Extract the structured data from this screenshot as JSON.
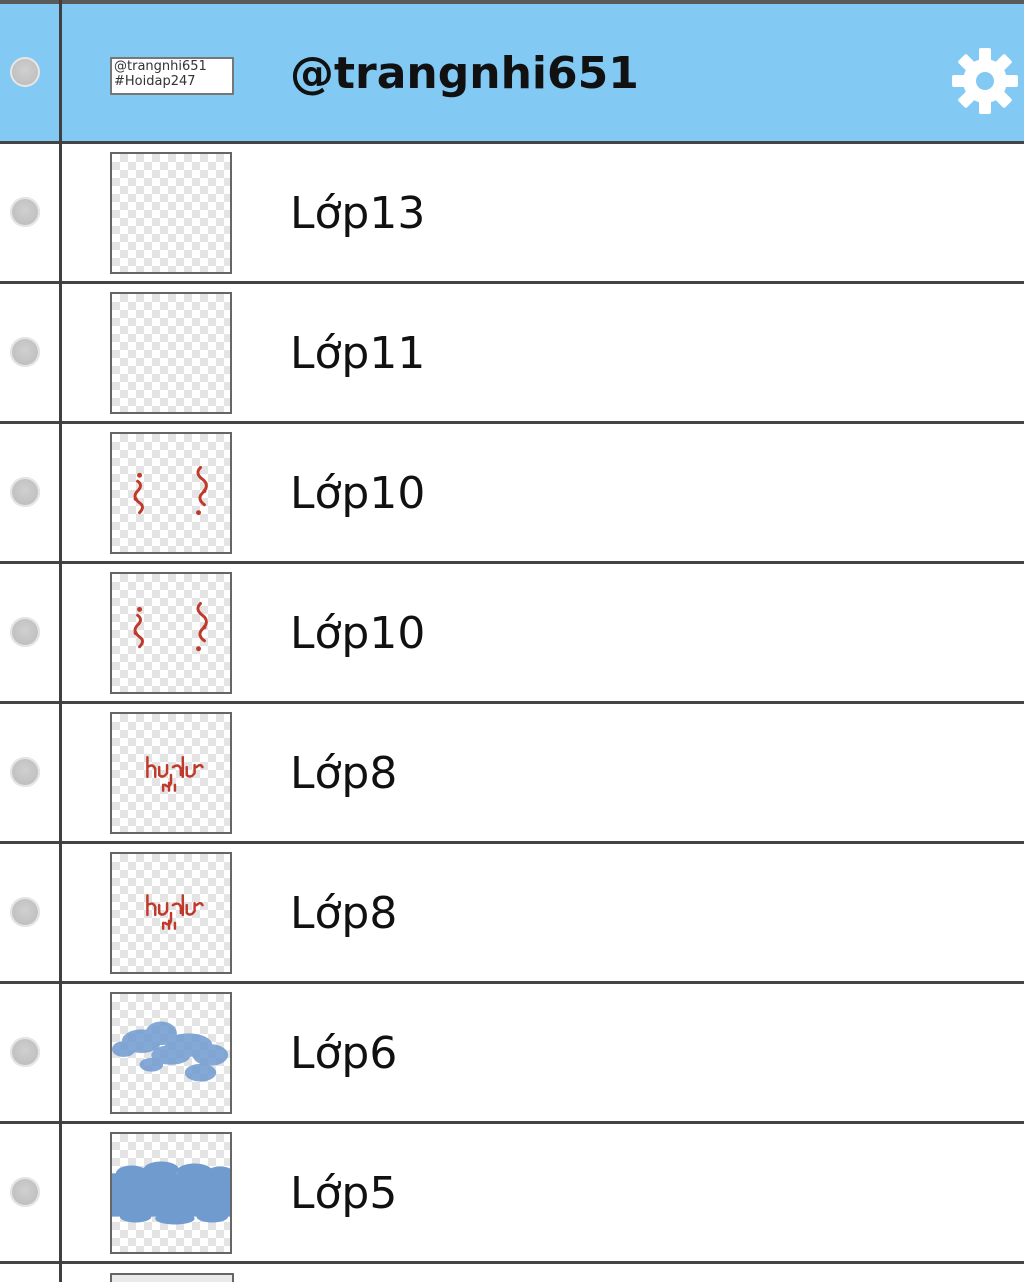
{
  "layers_panel": {
    "selected_layer": {
      "name": "@trangnhi651",
      "thumbnail_text_line1": "@trangnhi651",
      "thumbnail_text_line2": "#Hoidap247"
    },
    "layers": [
      {
        "name": "Lớp13",
        "thumbnail": "empty"
      },
      {
        "name": "Lớp11",
        "thumbnail": "empty"
      },
      {
        "name": "Lớp10",
        "thumbnail": "red-decorations"
      },
      {
        "name": "Lớp10",
        "thumbnail": "red-decorations"
      },
      {
        "name": "Lớp8",
        "thumbnail": "red-text"
      },
      {
        "name": "Lớp8",
        "thumbnail": "red-text"
      },
      {
        "name": "Lớp6",
        "thumbnail": "blue-clouds"
      },
      {
        "name": "Lớp5",
        "thumbnail": "blue-band"
      }
    ],
    "colors": {
      "selected_row": "#82c9f3",
      "divider": "#444444",
      "accent_red": "#c0392b",
      "cloud_blue": "#6f9bcf"
    }
  }
}
